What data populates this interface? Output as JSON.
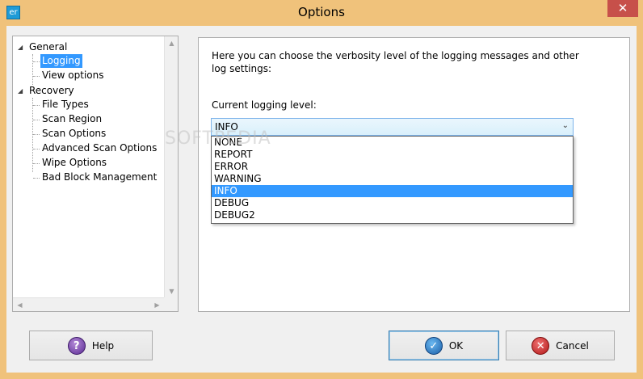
{
  "window": {
    "title": "Options",
    "app_icon_text": "er",
    "close_label": "✕"
  },
  "tree": {
    "nodes": [
      {
        "label": "General",
        "expanded": true
      },
      {
        "label": "Logging",
        "selected": true
      },
      {
        "label": "View options"
      },
      {
        "label": "Recovery",
        "expanded": true
      },
      {
        "label": "File Types"
      },
      {
        "label": "Scan Region"
      },
      {
        "label": "Scan Options"
      },
      {
        "label": "Advanced Scan Options"
      },
      {
        "label": "Wipe Options"
      },
      {
        "label": "Bad Block Management"
      }
    ]
  },
  "panel": {
    "description": "Here you can choose the verbosity level of the logging messages and other log settings:",
    "level_label": "Current logging level:",
    "selected_level": "INFO",
    "levels": [
      "NONE",
      "REPORT",
      "ERROR",
      "WARNING",
      "INFO",
      "DEBUG",
      "DEBUG2"
    ]
  },
  "watermark": "SOFTPEDIA",
  "buttons": {
    "help": "Help",
    "ok": "OK",
    "cancel": "Cancel"
  },
  "colors": {
    "frame": "#f0c27b",
    "selection": "#3399ff",
    "close": "#c7504a"
  }
}
